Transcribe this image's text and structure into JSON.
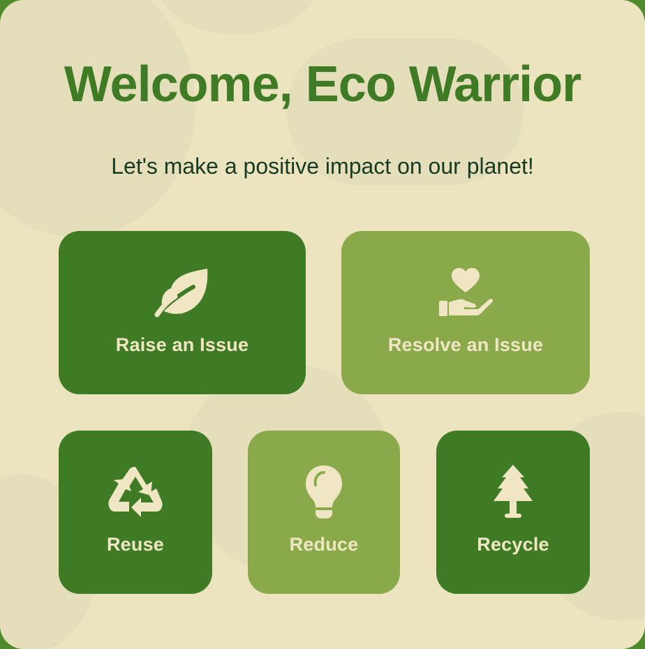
{
  "header": {
    "title": "Welcome, Eco Warrior",
    "subtitle": "Let's make a positive impact on our planet!"
  },
  "actions": [
    {
      "label": "Raise an Issue",
      "icon": "leaf-icon"
    },
    {
      "label": "Resolve an Issue",
      "icon": "hand-holding-heart-icon"
    }
  ],
  "categories": [
    {
      "label": "Reuse",
      "icon": "recycle-icon"
    },
    {
      "label": "Reduce",
      "icon": "lightbulb-icon"
    },
    {
      "label": "Recycle",
      "icon": "tree-icon"
    }
  ],
  "colors": {
    "tile_dark": "#3f7b25",
    "tile_light": "#8aa94a",
    "background": "#ebe4bf",
    "title": "#3f7b25",
    "label": "#f1e6c4"
  }
}
